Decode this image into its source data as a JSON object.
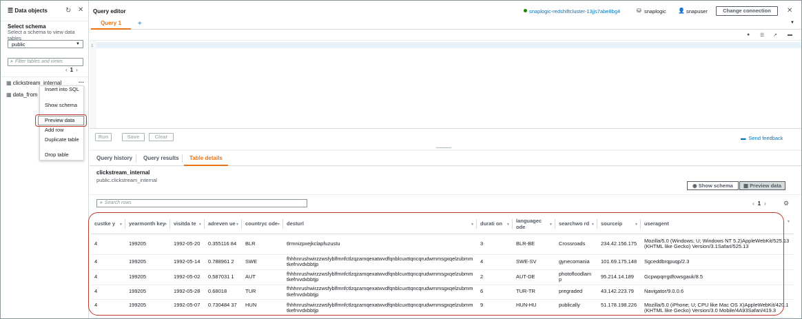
{
  "left_panel": {
    "title": "Data objects",
    "refresh_icon": "refresh-icon",
    "schema_label": "Select schema",
    "schema_description": "Select a schema to view data tables",
    "schema_value": "public",
    "filter_placeholder": "Filter tables and views",
    "page": "1",
    "tables": [
      "clickstream_internal",
      "data_from"
    ],
    "context_menu": [
      "Insert into SQL",
      "Show schema",
      "Preview data",
      "Add row",
      "Duplicate table",
      "Drop table"
    ]
  },
  "header": {
    "title": "Query editor",
    "connection": "snaplogic-redshiftcluster-13jjs7abe8bg4",
    "database": "snaplogic",
    "user": "snapuser",
    "change_connection": "Change connection"
  },
  "query_tabs": [
    "Query 1"
  ],
  "editor": {
    "line": "1",
    "run": "Run",
    "save": "Save",
    "clear": "Clear",
    "feedback": "Send feedback"
  },
  "result_tabs": [
    "Query history",
    "Query results",
    "Table details"
  ],
  "table_details": {
    "name": "clickstream_internal",
    "path": "public.clickstream_internal",
    "show_schema": "Show schema",
    "preview_data": "Preview data",
    "search_placeholder": "Search rows",
    "page": "1"
  },
  "table": {
    "columns": [
      "custke y",
      "yearmonth key",
      "visitda te",
      "adreven ue",
      "countryc ode",
      "desturl",
      "durati on",
      "languagec ode",
      "searchwo rd",
      "sourceip",
      "useragent"
    ],
    "rows": [
      [
        "4",
        "199205",
        "1992-05-20",
        "0.355116 84",
        "BLR",
        "tlrmnizpxejkclapfuzustu",
        "3",
        "BLR-BE",
        "Crossroads",
        "234.42.156.175",
        "Mozilla/5.0 (Windows; U; Windows NT 5.2)AppleWebKit/525.13 (KHTML like Gecko) Version/3.1Safari/525.13"
      ],
      [
        "4",
        "199205",
        "1992-05-14",
        "0.788961 2",
        "SWE",
        "fhhhnrushwirzzwsfyblfmnfctlzqzamqexatwvdfqnblcuxttqncqrudwmmsgxqelzubmmtkefrvvdxbbtjp",
        "4",
        "SWE-SV",
        "gynecomania",
        "101.69.175.148",
        "Sgceddbrqpuqp/2.3"
      ],
      [
        "4",
        "199205",
        "1992-05-02",
        "0.587031 1",
        "AUT",
        "fhhhnrushwirzzwsfyblfmnfctlzqzamqexatwvdfqnblcuxttqncqrudwmmsgxqelzubmmtkefrvvdxbbtjp",
        "2",
        "AUT-DE",
        "photofloodlamp",
        "95.214.14.189",
        "Gcpwpqrrgdfowsgauk/8.5"
      ],
      [
        "4",
        "199205",
        "1992-05-28",
        "0.68018",
        "TUR",
        "fhhhnrushwirzzwsfyblfmnfctlzqzamqexatwvdfqnblcuxttqncqrudwmmsgxqelzubmmtkefrvvdxbbtjp",
        "6",
        "TUR-TR",
        "pregraded",
        "43.142.223.79",
        "Navigator/9.0.0.6"
      ],
      [
        "4",
        "199205",
        "1992-05-07",
        "0.730484 37",
        "HUN",
        "fhhhnrushwirzzwsfyblfmnfctlzqzamqexatwvdfqnblcuxttqncqrudwmmsgxqelzubmmtkefrvvdxbbtjp",
        "9",
        "HUN-HU",
        "publically",
        "51.178.198.226",
        "Mozilla/5.0 (iPhone; U; CPU like Mac OS X)AppleWebKit/420.1 (KHTML like Gecko) Version/3.0 Mobile/4A93Safari/419.3"
      ]
    ]
  }
}
